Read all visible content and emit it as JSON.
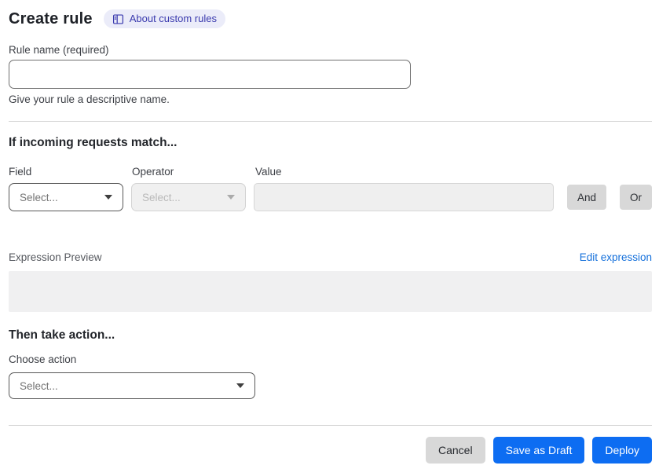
{
  "header": {
    "title": "Create rule",
    "about_link": "About custom rules"
  },
  "rule_name": {
    "label": "Rule name (required)",
    "value": "",
    "helper": "Give your rule a descriptive name."
  },
  "matcher": {
    "heading": "If incoming requests match...",
    "field_label": "Field",
    "operator_label": "Operator",
    "value_label": "Value",
    "field_placeholder": "Select...",
    "operator_placeholder": "Select...",
    "value_value": "",
    "and_label": "And",
    "or_label": "Or"
  },
  "expression": {
    "label": "Expression Preview",
    "edit_link": "Edit expression",
    "content": ""
  },
  "action": {
    "heading": "Then take action...",
    "label": "Choose action",
    "placeholder": "Select..."
  },
  "footer": {
    "cancel": "Cancel",
    "save_draft": "Save as Draft",
    "deploy": "Deploy"
  },
  "colors": {
    "accent_blue": "#0d6df2",
    "link_blue": "#1570db",
    "badge_bg": "#ebecf9",
    "badge_text": "#3a3aae"
  }
}
